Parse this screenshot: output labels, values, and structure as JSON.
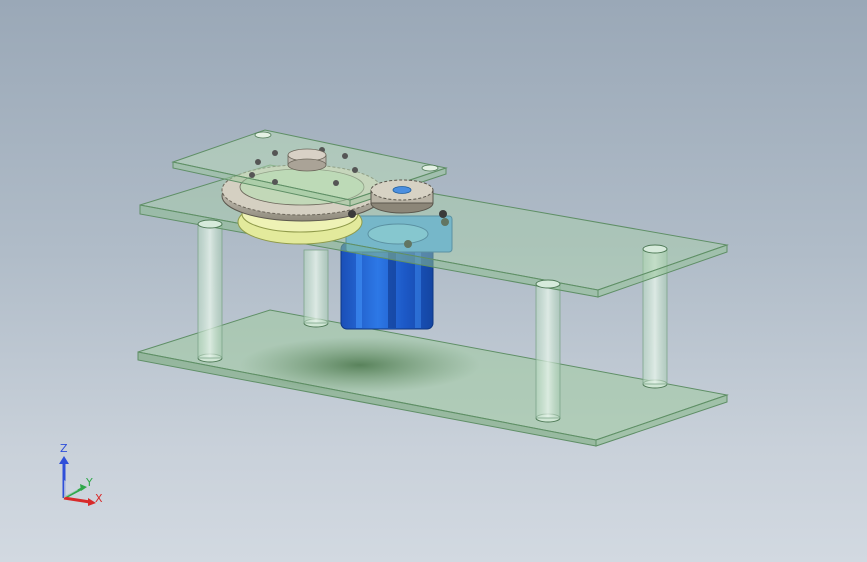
{
  "triad": {
    "z_label": "Z",
    "y_label": "Y",
    "x_label": "X",
    "z_color": "#2f4fd9",
    "y_color": "#2fa84a",
    "x_color": "#d82a2a"
  },
  "scene": {
    "plate_color": "#a9d3a8",
    "post_color": "#c7e2cf",
    "motor_color": "#1f63d6",
    "gear_color": "#bfb9a8",
    "hub_color": "#e6ec9a"
  }
}
